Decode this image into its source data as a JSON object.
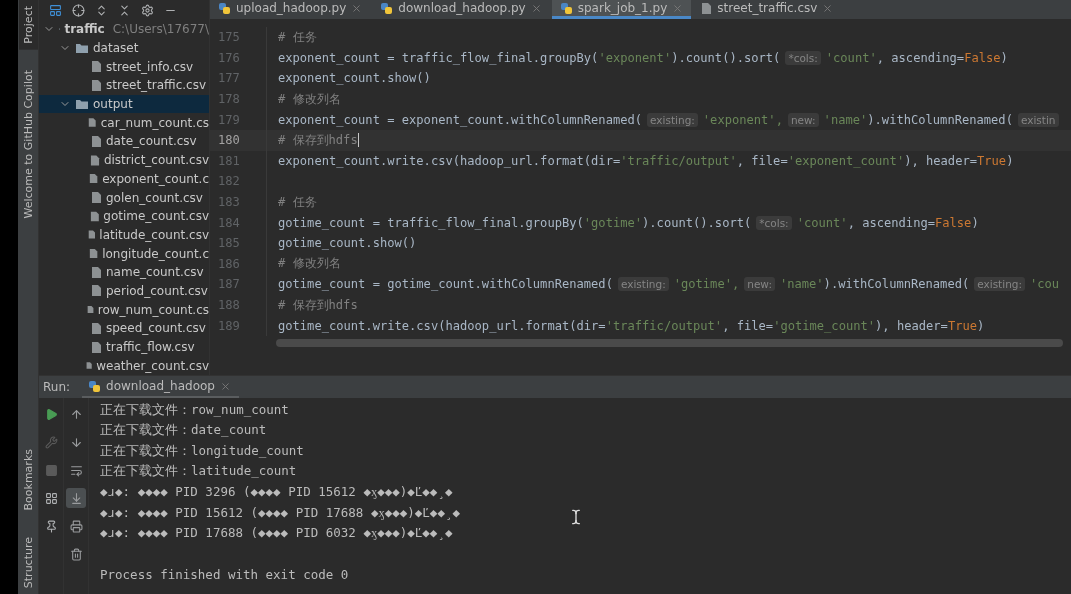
{
  "tool_strip": {
    "top": [
      {
        "label": "Project",
        "selected": true
      },
      {
        "label": "Welcome to GitHub Copilot",
        "selected": false
      }
    ],
    "bottom": [
      {
        "label": "Bookmarks"
      },
      {
        "label": "Structure"
      }
    ]
  },
  "project": {
    "tree": [
      {
        "name": "traffic",
        "path": "C:\\Users\\17677\\",
        "kind": "folder",
        "expanded": true,
        "selected": false,
        "children": [
          {
            "name": "dataset",
            "kind": "folder",
            "expanded": true,
            "selected": false,
            "children": [
              {
                "name": "street_info.csv",
                "kind": "file",
                "selected": false
              },
              {
                "name": "street_traffic.csv",
                "kind": "file",
                "selected": false
              }
            ]
          },
          {
            "name": "output",
            "kind": "folder",
            "expanded": true,
            "selected": true,
            "children": [
              {
                "name": "car_num_count.cs",
                "kind": "file",
                "selected": false
              },
              {
                "name": "date_count.csv",
                "kind": "file",
                "selected": false
              },
              {
                "name": "district_count.csv",
                "kind": "file",
                "selected": false
              },
              {
                "name": "exponent_count.c",
                "kind": "file",
                "selected": false
              },
              {
                "name": "golen_count.csv",
                "kind": "file",
                "selected": false
              },
              {
                "name": "gotime_count.csv",
                "kind": "file",
                "selected": false
              },
              {
                "name": "latitude_count.csv",
                "kind": "file",
                "selected": false
              },
              {
                "name": "longitude_count.c",
                "kind": "file",
                "selected": false
              },
              {
                "name": "name_count.csv",
                "kind": "file",
                "selected": false
              },
              {
                "name": "period_count.csv",
                "kind": "file",
                "selected": false
              },
              {
                "name": "row_num_count.cs",
                "kind": "file",
                "selected": false
              },
              {
                "name": "speed_count.csv",
                "kind": "file",
                "selected": false
              },
              {
                "name": "traffic_flow.csv",
                "kind": "file",
                "selected": false
              },
              {
                "name": "weather_count.csv",
                "kind": "file",
                "selected": false
              }
            ]
          }
        ]
      }
    ]
  },
  "editor": {
    "tabs": [
      {
        "label": "upload_hadoop.py",
        "kind": "python",
        "selected": false
      },
      {
        "label": "download_hadoop.py",
        "kind": "python",
        "selected": false
      },
      {
        "label": "spark_job_1.py",
        "kind": "python",
        "selected": true
      },
      {
        "label": "street_traffic.csv",
        "kind": "file",
        "selected": false
      }
    ],
    "lines": [
      {
        "number": "175",
        "current": false,
        "tokens": [
          {
            "kind": "comment",
            "text": "# 任务"
          }
        ]
      },
      {
        "number": "176",
        "current": false,
        "tokens": [
          {
            "kind": "plain",
            "text": "exponent_count = traffic_flow_final.groupBy("
          },
          {
            "kind": "string",
            "text": "'exponent'"
          },
          {
            "kind": "plain",
            "text": ").count().sort("
          },
          {
            "kind": "hint",
            "text": "*cols:"
          },
          {
            "kind": "string",
            "text": "'count'"
          },
          {
            "kind": "plain",
            "text": ", ascending="
          },
          {
            "kind": "keyword",
            "text": "False"
          },
          {
            "kind": "plain",
            "text": ")"
          }
        ]
      },
      {
        "number": "177",
        "current": false,
        "tokens": [
          {
            "kind": "plain",
            "text": "exponent_count.show()"
          }
        ]
      },
      {
        "number": "178",
        "current": false,
        "tokens": [
          {
            "kind": "comment",
            "text": "# 修改列名"
          }
        ]
      },
      {
        "number": "179",
        "current": false,
        "tokens": [
          {
            "kind": "plain",
            "text": "exponent_count = exponent_count.withColumnRenamed("
          },
          {
            "kind": "hint",
            "text": "existing:"
          },
          {
            "kind": "string",
            "text": "'exponent',"
          },
          {
            "kind": "hint",
            "text": "new:"
          },
          {
            "kind": "string",
            "text": "'name'"
          },
          {
            "kind": "plain",
            "text": ").withColumnRenamed("
          },
          {
            "kind": "hint",
            "text": "existin"
          }
        ]
      },
      {
        "number": "180",
        "current": true,
        "tokens": [
          {
            "kind": "comment",
            "text": "# 保存到hdfs"
          }
        ]
      },
      {
        "number": "181",
        "current": false,
        "tokens": [
          {
            "kind": "plain",
            "text": "exponent_count.write.csv(hadoop_url.format(dir="
          },
          {
            "kind": "string",
            "text": "'traffic/output'"
          },
          {
            "kind": "plain",
            "text": ", file="
          },
          {
            "kind": "string",
            "text": "'exponent_count'"
          },
          {
            "kind": "plain",
            "text": "), header="
          },
          {
            "kind": "keyword",
            "text": "True"
          },
          {
            "kind": "plain",
            "text": ")"
          }
        ]
      },
      {
        "number": "182",
        "current": false
      },
      {
        "number": "183",
        "current": false,
        "tokens": [
          {
            "kind": "comment",
            "text": "# 任务"
          }
        ]
      },
      {
        "number": "184",
        "current": false,
        "tokens": [
          {
            "kind": "plain",
            "text": "gotime_count = traffic_flow_final.groupBy("
          },
          {
            "kind": "string",
            "text": "'gotime'"
          },
          {
            "kind": "plain",
            "text": ").count().sort("
          },
          {
            "kind": "hint",
            "text": "*cols:"
          },
          {
            "kind": "string",
            "text": "'count'"
          },
          {
            "kind": "plain",
            "text": ", ascending="
          },
          {
            "kind": "keyword",
            "text": "False"
          },
          {
            "kind": "plain",
            "text": ")"
          }
        ]
      },
      {
        "number": "185",
        "current": false,
        "tokens": [
          {
            "kind": "plain",
            "text": "gotime_count.show()"
          }
        ]
      },
      {
        "number": "186",
        "current": false,
        "tokens": [
          {
            "kind": "comment",
            "text": "# 修改列名"
          }
        ]
      },
      {
        "number": "187",
        "current": false,
        "tokens": [
          {
            "kind": "plain",
            "text": "gotime_count = gotime_count.withColumnRenamed("
          },
          {
            "kind": "hint",
            "text": "existing:"
          },
          {
            "kind": "string",
            "text": "'gotime',"
          },
          {
            "kind": "hint",
            "text": "new:"
          },
          {
            "kind": "string",
            "text": "'name'"
          },
          {
            "kind": "plain",
            "text": ").withColumnRenamed("
          },
          {
            "kind": "hint",
            "text": "existing:"
          },
          {
            "kind": "string",
            "text": "'cou"
          }
        ]
      },
      {
        "number": "188",
        "current": false,
        "tokens": [
          {
            "kind": "comment",
            "text": "# 保存到hdfs"
          }
        ]
      },
      {
        "number": "189",
        "current": false,
        "tokens": [
          {
            "kind": "plain",
            "text": "gotime_count.write.csv(hadoop_url.format(dir="
          },
          {
            "kind": "string",
            "text": "'traffic/output'"
          },
          {
            "kind": "plain",
            "text": ", file="
          },
          {
            "kind": "string",
            "text": "'gotime_count'"
          },
          {
            "kind": "plain",
            "text": "), header="
          },
          {
            "kind": "keyword",
            "text": "True"
          },
          {
            "kind": "plain",
            "text": ")"
          }
        ]
      }
    ]
  },
  "run": {
    "label": "Run:",
    "tab": {
      "label": "download_hadoop"
    },
    "tools": [
      {
        "kind": "run",
        "disabled": false
      },
      {
        "kind": "wrench",
        "disabled": true
      },
      {
        "kind": "stop",
        "disabled": true
      },
      {
        "kind": "layout",
        "disabled": false
      },
      {
        "kind": "pin",
        "disabled": false
      }
    ],
    "actions": [
      {
        "kind": "up",
        "selected": false
      },
      {
        "kind": "down",
        "selected": false
      },
      {
        "kind": "wrap",
        "selected": false
      },
      {
        "kind": "scroll-end",
        "selected": true
      },
      {
        "kind": "print",
        "selected": false
      },
      {
        "kind": "trash",
        "selected": false
      }
    ],
    "output": [
      "正在下载文件：row_num_count",
      "正在下载文件：date_count",
      "正在下载文件：longitude_count",
      "正在下载文件：latitude_count",
      "◆ɹ◆: ◆◆◆◆ PID 3296 (◆◆◆◆ PID 15612 ◆ӽ◆◆◆)◆Ľ◆◆¸◆",
      "◆ɹ◆: ◆◆◆◆ PID 15612 (◆◆◆◆ PID 17688 ◆ӽ◆◆◆)◆Ľ◆◆¸◆",
      "◆ɹ◆: ◆◆◆◆ PID 17688 (◆◆◆◆ PID 6032 ◆ӽ◆◆◆)◆Ľ◆◆¸◆"
    ],
    "exit_message": "Process finished with exit code 0"
  }
}
